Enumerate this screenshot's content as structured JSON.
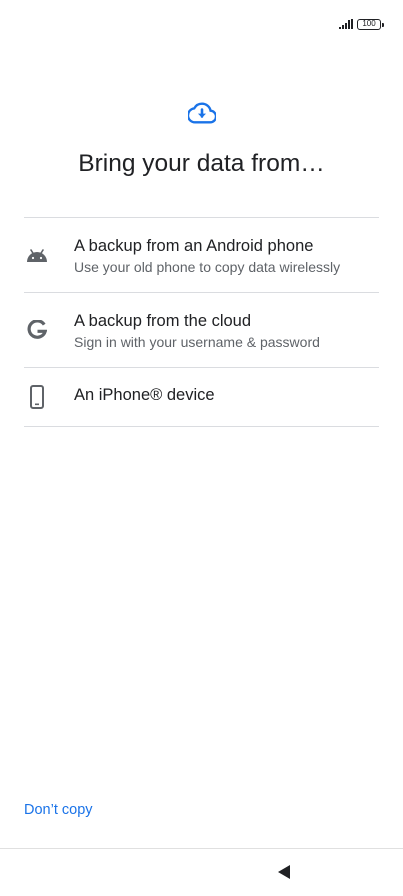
{
  "status_bar": {
    "battery_level": "100",
    "signal_icon": "signal-bars-icon"
  },
  "header": {
    "icon": "cloud-download-icon",
    "icon_color": "#1a73e8",
    "title": "Bring your data from…"
  },
  "options": [
    {
      "icon": "android-icon",
      "title": "A backup from an Android phone",
      "subtitle": "Use your old phone to copy data wirelessly"
    },
    {
      "icon": "google-g-icon",
      "title": "A backup from the cloud",
      "subtitle": "Sign in with your username & password"
    },
    {
      "icon": "phone-icon",
      "title": "An iPhone® device",
      "subtitle": ""
    }
  ],
  "footer": {
    "skip_label": "Don’t copy",
    "accent": "#1a73e8"
  },
  "nav_bar": {
    "back_icon": "back-triangle-icon"
  }
}
